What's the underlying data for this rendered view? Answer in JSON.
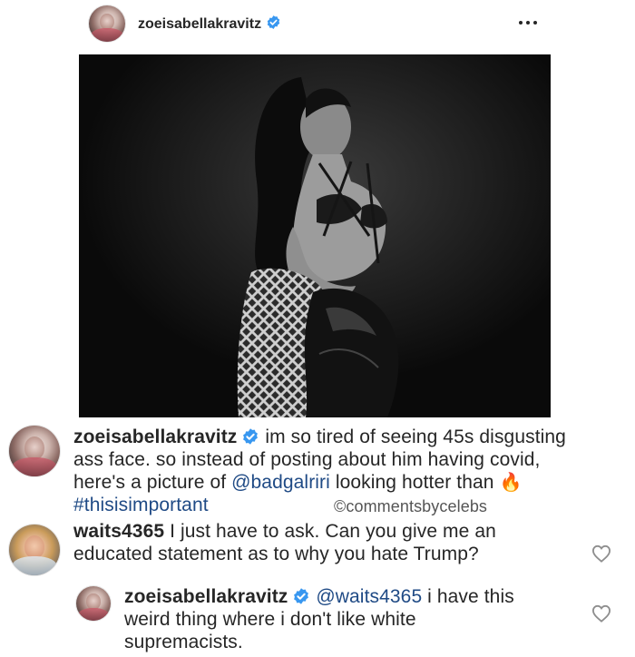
{
  "post": {
    "author": "zoeisabellakravitz",
    "more_icon": "more-horizontal-icon",
    "image_icon": "photo"
  },
  "caption": {
    "author": "zoeisabellakravitz",
    "line1": "im so tired of seeing 45s disgusting",
    "line2": "ass face. so instead of posting about him having covid,",
    "line3_pre": "here's a picture of ",
    "mention": "@badgalriri",
    "line3_post": " looking hotter than ",
    "emoji": "🔥",
    "hashtag": "#thisisimportant",
    "watermark": "©commentsbycelebs"
  },
  "comments": [
    {
      "author": "waits4365",
      "line1": " I just have to ask. Can you give me an",
      "line2": "educated statement as to why you hate Trump?",
      "like_icon": "heart-outline-icon"
    },
    {
      "author": "zoeisabellakravitz",
      "mention": "@waits4365",
      "line1_post": " i have this",
      "line2": "weird thing where i don't like white",
      "line3": "supremacists.",
      "like_icon": "heart-outline-icon"
    }
  ],
  "colors": {
    "verified_badge": "#3897f0",
    "mention": "#1f4a85",
    "text": "#262626"
  }
}
